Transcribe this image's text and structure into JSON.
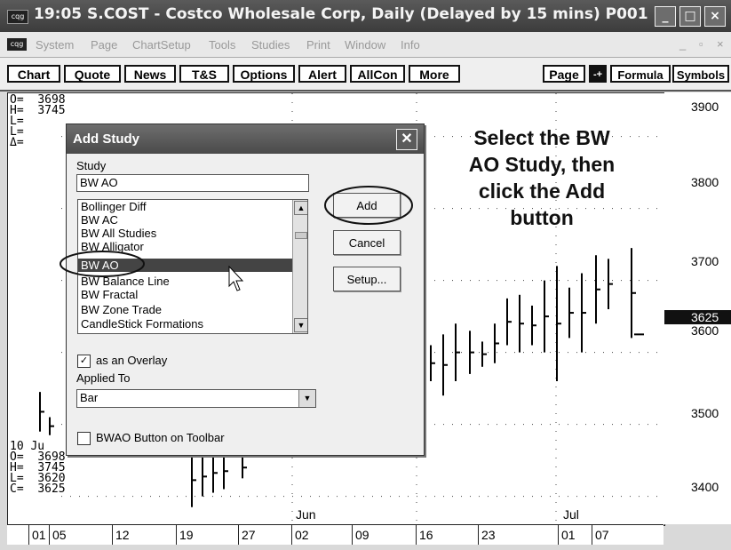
{
  "window": {
    "title": "19:05  S.COST - Costco Wholesale Corp, Daily (Delayed by 15 mins)  P001",
    "app_icon": "cqg",
    "buttons": [
      "_",
      "□",
      "×"
    ]
  },
  "menu": {
    "items": [
      "System",
      "Page",
      "ChartSetup",
      "Tools",
      "Studies",
      "Print",
      "Window",
      "Info"
    ],
    "right": [
      "_",
      "▫",
      "×"
    ]
  },
  "toolbar": {
    "buttons": [
      "Chart",
      "Quote",
      "News",
      "T&S",
      "Options",
      "Alert",
      "AllCon",
      "More"
    ],
    "right_buttons": [
      "Page",
      "-+",
      "Formula",
      "Symbols"
    ]
  },
  "chart": {
    "top_readout": {
      "o": "O=",
      "o_val": "3698",
      "h": "H=",
      "h_val": "3745",
      "l": "L=",
      "c": "L=",
      "d": "Δ="
    },
    "bottom_readout": {
      "date": "10 Ju",
      "o": "O=",
      "o_val": "3698",
      "h": "H=",
      "h_val": "3745",
      "l": "L=",
      "l_val": "3620",
      "c": "C=",
      "c_val": "3625"
    },
    "y_labels": [
      "3900",
      "3800",
      "3700",
      "3625",
      "3600",
      "3500",
      "3400"
    ],
    "current_price": "3625",
    "month_labels": [
      "Jun",
      "Jul"
    ],
    "x_labels": [
      "01",
      "05",
      "12",
      "19",
      "27",
      "02",
      "09",
      "16",
      "23",
      "01",
      "07"
    ]
  },
  "chart_data": {
    "type": "bar",
    "title": "",
    "ylabel": "",
    "ylim": [
      3360,
      3960
    ],
    "bars": [
      {
        "h": 3545,
        "l": 3490
      },
      {
        "h": 3510,
        "l": 3485
      },
      {
        "h": 3460,
        "l": 3385
      },
      {
        "h": 3455,
        "l": 3400
      },
      {
        "h": 3460,
        "l": 3405
      },
      {
        "h": 3460,
        "l": 3410
      },
      {
        "h": 3455,
        "l": 3425
      },
      {
        "h": 3610,
        "l": 3560
      },
      {
        "h": 3625,
        "l": 3540
      },
      {
        "h": 3640,
        "l": 3560
      },
      {
        "h": 3630,
        "l": 3570
      },
      {
        "h": 3615,
        "l": 3580
      },
      {
        "h": 3640,
        "l": 3585
      },
      {
        "h": 3675,
        "l": 3610
      },
      {
        "h": 3680,
        "l": 3600
      },
      {
        "h": 3665,
        "l": 3610
      },
      {
        "h": 3700,
        "l": 3600
      },
      {
        "h": 3720,
        "l": 3560
      },
      {
        "h": 3690,
        "l": 3620
      },
      {
        "h": 3710,
        "l": 3600
      },
      {
        "h": 3735,
        "l": 3640
      },
      {
        "h": 3730,
        "l": 3660
      },
      {
        "h": 3745,
        "l": 3620
      }
    ]
  },
  "dialog": {
    "title": "Add Study",
    "study_label": "Study",
    "study_value": "BW AO",
    "list": [
      "Bollinger Diff",
      "BW AC",
      "BW All Studies",
      "BW Alligator",
      "BW AO",
      "BW Balance Line",
      "BW Fractal",
      "BW Zone Trade",
      "CandleStick Formations"
    ],
    "selected": "BW AO",
    "add_label": "Add",
    "cancel_label": "Cancel",
    "setup_label": "Setup...",
    "overlay_label": "as an Overlay",
    "overlay_checked": "✓",
    "applied_label": "Applied To",
    "applied_value": "Bar",
    "button_toolbar_label": "BWAO Button on Toolbar"
  },
  "annotation": {
    "lines": [
      "Select the BW",
      "AO Study, then",
      "click the Add",
      "button"
    ]
  }
}
